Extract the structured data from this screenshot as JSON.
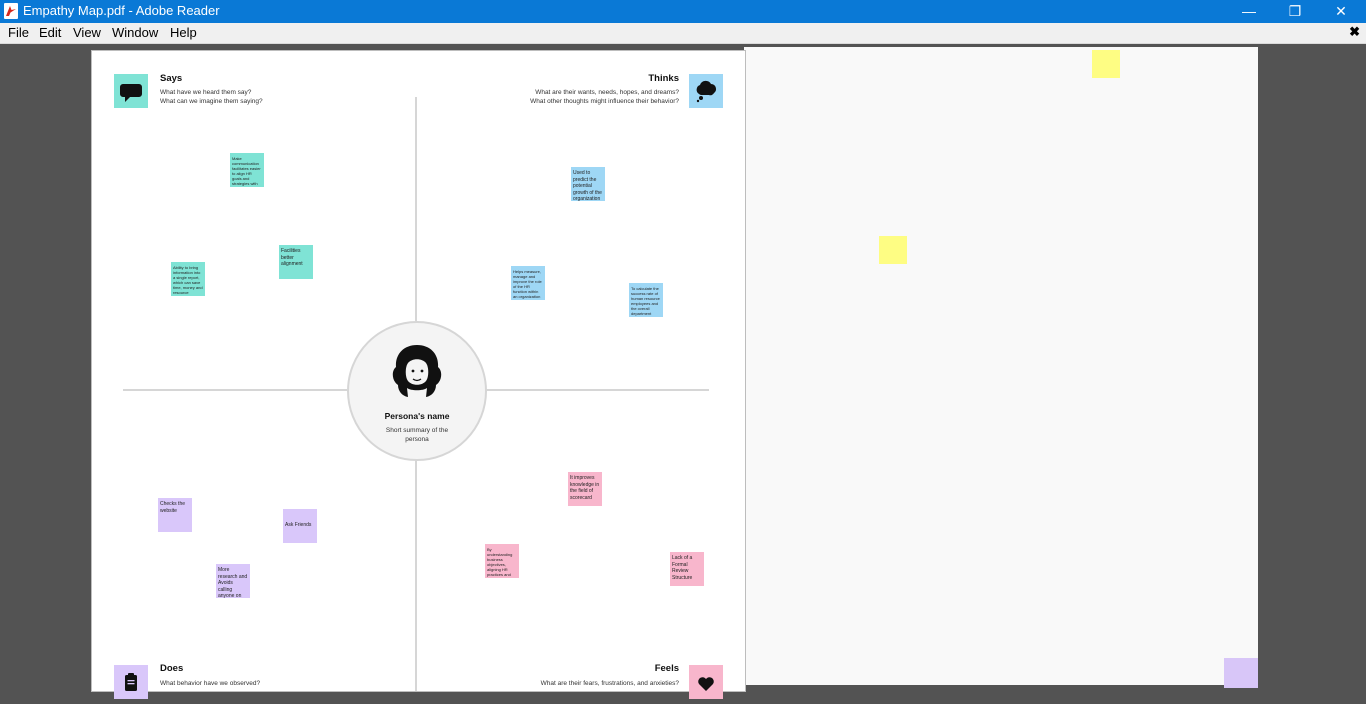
{
  "window": {
    "title": "Empathy Map.pdf - Adobe Reader",
    "minimize_glyph": "—",
    "restore_glyph": "❐",
    "close_glyph": "✕"
  },
  "menu": {
    "items": [
      "File",
      "Edit",
      "View",
      "Window",
      "Help"
    ],
    "doc_close_glyph": "✖"
  },
  "page": {
    "says": {
      "title": "Says",
      "sub1": "What have we heard them say?",
      "sub2": "What can we imagine them saying?",
      "icon": "speech-bubble-icon",
      "color": "#7fe3d5"
    },
    "thinks": {
      "title": "Thinks",
      "sub1": "What are their wants, needs, hopes, and dreams?",
      "sub2": "What other thoughts might influence their behavior?",
      "icon": "thought-cloud-icon",
      "color": "#9ed7f5"
    },
    "does": {
      "title": "Does",
      "sub1": "What behavior have we observed?",
      "icon": "clipboard-icon",
      "color": "#d9c7fa"
    },
    "feels": {
      "title": "Feels",
      "sub1": "What are their fears, frustrations, and anxieties?",
      "icon": "heart-icon",
      "color": "#f8b6cc"
    },
    "persona": {
      "name": "Persona's name",
      "summary": "Short summary of the persona",
      "icon": "persona-avatar-icon"
    },
    "notes": {
      "says": [
        "Make communication facilitates easier to align HR goals and strategies with the overall mission of strategies of the whole organization",
        "Facilities better alignment",
        "Ability to bring information into a single report, which can save time, money and resource"
      ],
      "thinks": [
        "Used to predict the potential growth of the organization",
        "Helps measure, manage and improve the role of the HR function within an organization",
        "To calculate the success rate of human resource employees and the overall department"
      ],
      "does": [
        "Checks the website",
        "Ask Friends",
        "More research and Avoids calling anyone on the phone"
      ],
      "feels": [
        "It improves knowledge in the field of scorecard",
        "By understanding business objectives, aligning HR practices and contributing to overall organizational success, HR can illustrate its value and influence",
        "Lack of a Formal Review Structure"
      ]
    }
  }
}
